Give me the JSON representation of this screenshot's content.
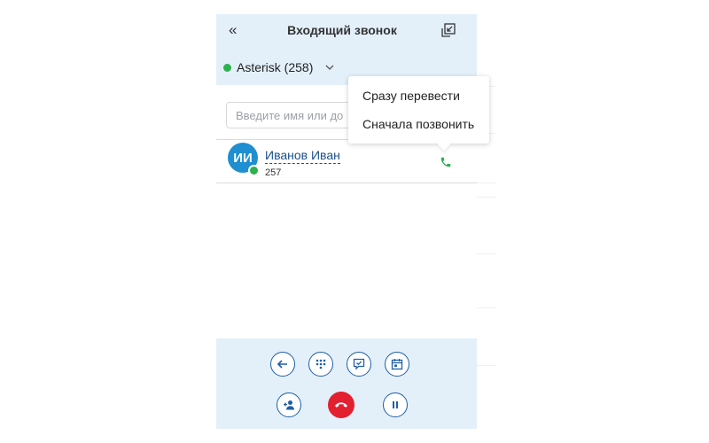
{
  "header": {
    "title": "Входящий звонок",
    "collapse_icon": "double-chevron-left-icon",
    "minimize_icon": "minimize-window-icon"
  },
  "account": {
    "name": "Asterisk (258)",
    "status_color": "#2bb24c"
  },
  "search": {
    "placeholder": "Введите имя или до",
    "value": ""
  },
  "contact": {
    "initials": "ИИ",
    "name": "Иванов Иван",
    "number": "257",
    "avatar_color": "#1e8fd0",
    "presence_color": "#2bb24c"
  },
  "transfer_menu": {
    "items": [
      "Сразу перевести",
      "Сначала позвонить"
    ]
  },
  "controls": {
    "row1": [
      "back-arrow-icon",
      "dialpad-icon",
      "chat-check-icon",
      "calendar-icon"
    ],
    "row2": [
      "add-participant-icon",
      "hang-up-icon",
      "pause-icon"
    ],
    "accent": "#1f5fa8",
    "hangup_color": "#e3202f"
  }
}
